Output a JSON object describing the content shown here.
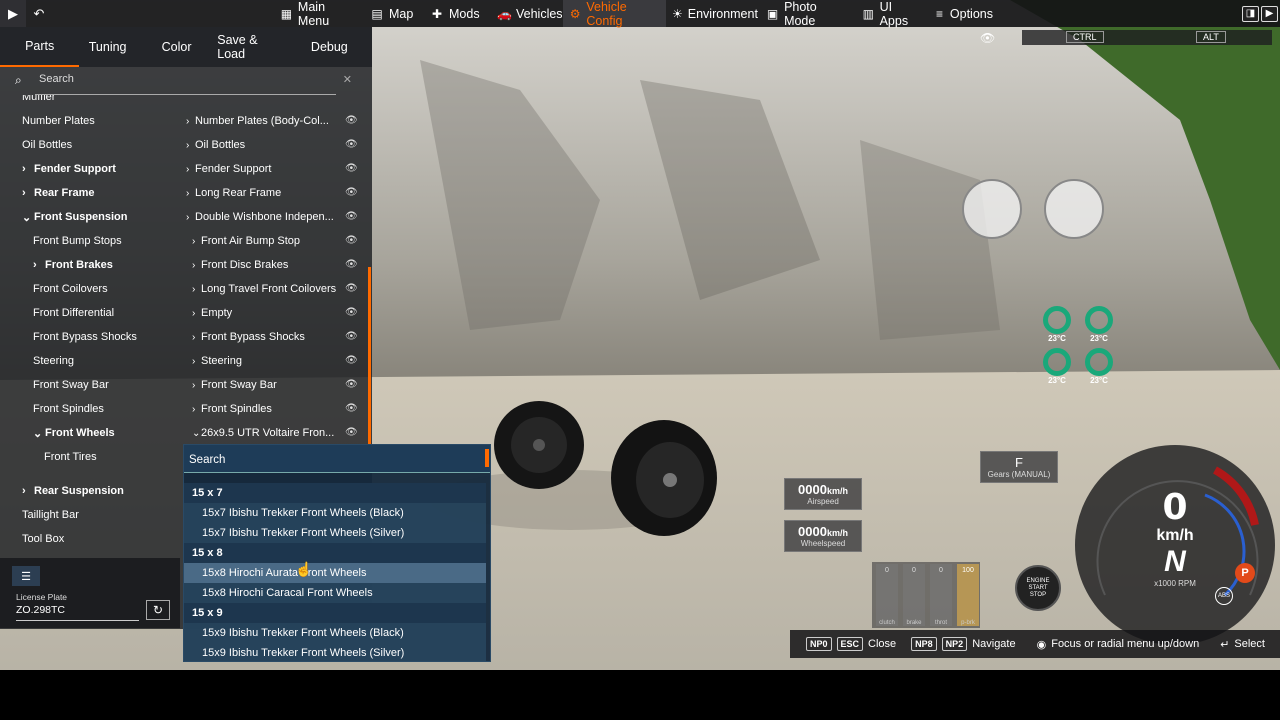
{
  "topbar": {
    "play_icon": "play-icon",
    "undo_icon": "undo-icon",
    "menu": [
      {
        "label": "Main Menu",
        "icon": "grid-icon",
        "glyph": "▦"
      },
      {
        "label": "Map",
        "icon": "map-icon",
        "glyph": "▤"
      },
      {
        "label": "Mods",
        "icon": "puzzle-icon",
        "glyph": "✚"
      },
      {
        "label": "Vehicles",
        "icon": "car-icon",
        "glyph": "🚗"
      },
      {
        "label": "Vehicle Config",
        "icon": "car-config-icon",
        "glyph": "⚙"
      },
      {
        "label": "Environment",
        "icon": "sun-icon",
        "glyph": "☀"
      },
      {
        "label": "Photo Mode",
        "icon": "camera-icon",
        "glyph": "▣"
      },
      {
        "label": "UI Apps",
        "icon": "apps-icon",
        "glyph": "▥"
      },
      {
        "label": "Options",
        "icon": "sliders-icon",
        "glyph": "≡"
      }
    ]
  },
  "panel": {
    "tabs": [
      "Parts",
      "Tuning",
      "Color",
      "Save & Load",
      "Debug"
    ],
    "search_placeholder": "Search",
    "left_items": [
      {
        "label": "Muffler",
        "bold": false
      },
      {
        "label": "Number Plates",
        "bold": false
      },
      {
        "label": "Oil Bottles",
        "bold": false
      },
      {
        "label": "Fender Support",
        "bold": true,
        "arrow": "›"
      },
      {
        "label": "Rear Frame",
        "bold": true,
        "arrow": "›"
      },
      {
        "label": "Front Suspension",
        "bold": true,
        "arrow": "⌄"
      },
      {
        "label": "Front Bump Stops",
        "bold": false
      },
      {
        "label": "Front Brakes",
        "bold": true,
        "arrow": "›"
      },
      {
        "label": "Front Coilovers",
        "bold": false
      },
      {
        "label": "Front Differential",
        "bold": false
      },
      {
        "label": "Front Bypass Shocks",
        "bold": false
      },
      {
        "label": "Steering",
        "bold": false
      },
      {
        "label": "Front Sway Bar",
        "bold": false
      },
      {
        "label": "Front Spindles",
        "bold": false
      },
      {
        "label": "Front Wheels",
        "bold": true,
        "arrow": "⌄"
      },
      {
        "label": "Front Tires",
        "bold": false
      },
      {
        "label": "Rear Suspension",
        "bold": true,
        "arrow": "›"
      },
      {
        "label": "Taillight Bar",
        "bold": false
      },
      {
        "label": "Tool Box",
        "bold": false
      }
    ],
    "right_items": [
      "Number Plates (Body-Col...",
      "Oil Bottles",
      "Fender Support",
      "Long Rear Frame",
      "Double Wishbone Indepen...",
      "Front Air Bump Stop",
      "Front Disc Brakes",
      "Long Travel Front Coilovers",
      "Empty",
      "Front Bypass Shocks",
      "Steering",
      "Front Sway Bar",
      "Front Spindles",
      "26x9.5 UTR Voltaire Fron..."
    ],
    "license_label": "License Plate",
    "license_value": "ZO.298TC"
  },
  "dropdown": {
    "search_label": "Search",
    "items": [
      {
        "text": "15 x 7",
        "type": "hdr"
      },
      {
        "text": "15x7 Ibishu Trekker Front Wheels (Black)",
        "type": "item"
      },
      {
        "text": "15x7 Ibishu Trekker Front Wheels (Silver)",
        "type": "item"
      },
      {
        "text": "15 x 8",
        "type": "hdr"
      },
      {
        "text": "15x8 Hirochi Aurata Front Wheels",
        "type": "hl"
      },
      {
        "text": "15x8 Hirochi Caracal Front Wheels",
        "type": "item"
      },
      {
        "text": "15 x 9",
        "type": "hdr"
      },
      {
        "text": "15x9 Ibishu Trekker Front Wheels (Black)",
        "type": "item"
      },
      {
        "text": "15x9 Ibishu Trekker Front Wheels (Silver)",
        "type": "item"
      }
    ]
  },
  "hud": {
    "ctrl": "CTRL",
    "alt": "ALT",
    "airspeed_value": "0000",
    "airspeed_unit": "km/h",
    "airspeed_label": "Airspeed",
    "wheelspeed_value": "0000",
    "wheelspeed_unit": "km/h",
    "wheelspeed_label": "Wheelspeed",
    "gear": "F",
    "gear_label": "Gears (MANUAL)",
    "pedals": [
      {
        "label": "clutch",
        "value": "0"
      },
      {
        "label": "brake",
        "value": "0"
      },
      {
        "label": "throt",
        "value": "0"
      },
      {
        "label": "p-brk",
        "value": "100"
      }
    ],
    "engine_btn": "ENGINE START STOP",
    "speed": "0",
    "speed_unit": "km/h",
    "gear_display": "N",
    "rpm_label": "x1000 RPM",
    "temps": [
      "23°C",
      "23°C",
      "23°C",
      "23°C"
    ]
  },
  "hints": [
    {
      "keys": [
        "NP0",
        "ESC"
      ],
      "label": "Close"
    },
    {
      "keys": [
        "NP8",
        "NP2"
      ],
      "label": "Navigate"
    },
    {
      "keys": [],
      "label": "Focus or radial menu up/down"
    },
    {
      "keys": [],
      "label": "Select"
    }
  ]
}
